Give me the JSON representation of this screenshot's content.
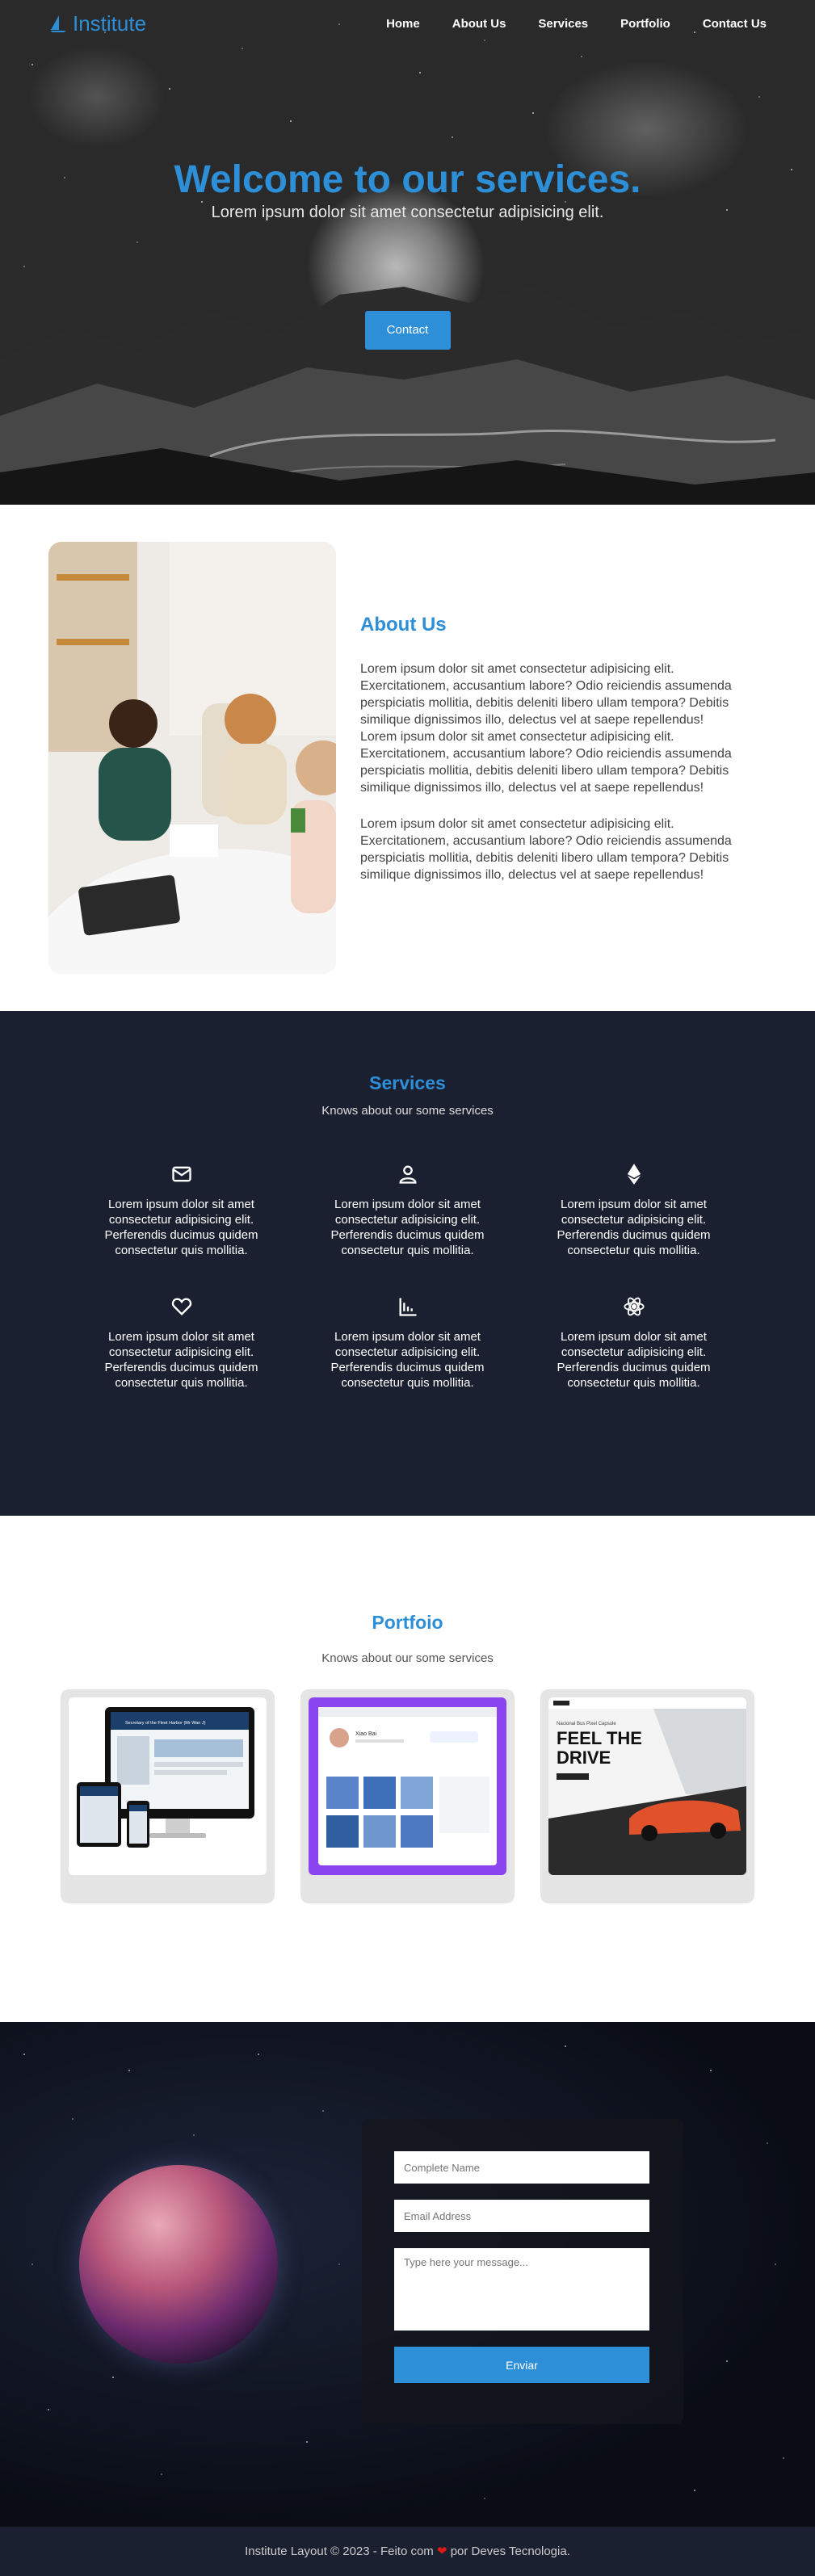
{
  "brand": {
    "name": "Institute",
    "accent_color": "#2d8fd8"
  },
  "nav": {
    "items": [
      {
        "label": "Home"
      },
      {
        "label": "About Us"
      },
      {
        "label": "Services"
      },
      {
        "label": "Portfolio"
      },
      {
        "label": "Contact Us"
      }
    ]
  },
  "hero": {
    "title": "Welcome to our services.",
    "subtitle": "Lorem ipsum dolor sit amet consectetur adipisicing elit.",
    "button_label": "Contact"
  },
  "about": {
    "title": "About Us",
    "paragraphs": [
      "Lorem ipsum dolor sit amet consectetur adipisicing elit. Exercitationem, accusantium labore? Odio reiciendis assumenda perspiciatis mollitia, debitis deleniti libero ullam tempora? Debitis similique dignissimos illo, delectus vel at saepe repellendus! Lorem ipsum dolor sit amet consectetur adipisicing elit. Exercitationem, accusantium labore? Odio reiciendis assumenda perspiciatis mollitia, debitis deleniti libero ullam tempora? Debitis similique dignissimos illo, delectus vel at saepe repellendus!",
      "Lorem ipsum dolor sit amet consectetur adipisicing elit. Exercitationem, accusantium labore? Odio reiciendis assumenda perspiciatis mollitia, debitis deleniti libero ullam tempora? Debitis similique dignissimos illo, delectus vel at saepe repellendus!"
    ]
  },
  "services": {
    "title": "Services",
    "subtitle": "Knows about our some services",
    "items": [
      {
        "icon": "envelope-icon",
        "text": "Lorem ipsum dolor sit amet consectetur adipisicing elit. Perferendis ducimus quidem consectetur quis mollitia."
      },
      {
        "icon": "user-icon",
        "text": "Lorem ipsum dolor sit amet consectetur adipisicing elit. Perferendis ducimus quidem consectetur quis mollitia."
      },
      {
        "icon": "ethereum-icon",
        "text": "Lorem ipsum dolor sit amet consectetur adipisicing elit. Perferendis ducimus quidem consectetur quis mollitia."
      },
      {
        "icon": "heart-icon",
        "text": "Lorem ipsum dolor sit amet consectetur adipisicing elit. Perferendis ducimus quidem consectetur quis mollitia."
      },
      {
        "icon": "bar-chart-icon",
        "text": "Lorem ipsum dolor sit amet consectetur adipisicing elit. Perferendis ducimus quidem consectetur quis mollitia."
      },
      {
        "icon": "atom-icon",
        "text": "Lorem ipsum dolor sit amet consectetur adipisicing elit. Perferendis ducimus quidem consectetur quis mollitia."
      }
    ]
  },
  "portfolio": {
    "title": "Portfoio",
    "subtitle": "Knows about our some services",
    "items": [
      {
        "heading": "Secretary of the Fleet Harbor (Mr Wan J)"
      },
      {
        "heading": "Xiao Bai"
      },
      {
        "kicker": "Nacional Bus Pixel Capsule",
        "headline_line1": "FEEL THE",
        "headline_line2": "DRIVE"
      }
    ]
  },
  "contact": {
    "name_placeholder": "Complete Name",
    "email_placeholder": "Email Address",
    "message_placeholder": "Type here your message...",
    "submit_label": "Enviar"
  },
  "footer": {
    "text_before": "Institute Layout © 2023 - Feito com ",
    "heart": "❤",
    "text_after": " por Deves Tecnologia."
  }
}
